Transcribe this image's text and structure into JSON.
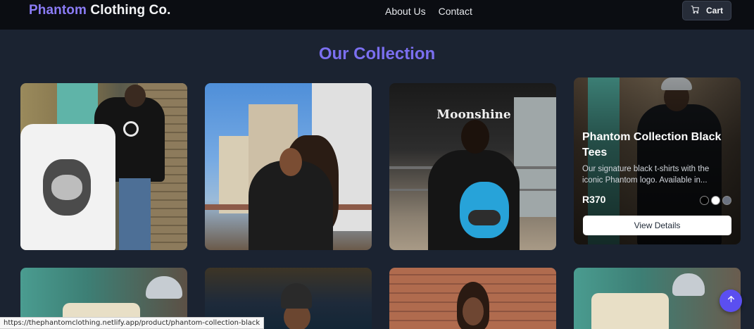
{
  "header": {
    "brand_accent": "Phantom",
    "brand_rest": "Clothing Co.",
    "nav": [
      {
        "label": "About Us"
      },
      {
        "label": "Contact"
      }
    ],
    "cart_label": "Cart"
  },
  "main": {
    "section_title": "Our Collection",
    "featured_product": {
      "title": "Phantom Collection Black Tees",
      "description": "Our signature black t-shirts with the iconic Phantom logo. Available in...",
      "price": "R370",
      "swatch_colors": [
        "#000000",
        "#ffffff",
        "#6b7280"
      ],
      "button_label": "View Details"
    },
    "storefront_sign": "Moonshine"
  },
  "status_bar": {
    "url": "https://thephantomclothing.netlify.app/product/phantom-collection-black"
  },
  "colors": {
    "accent": "#7b6ff0",
    "background": "#1b2331",
    "header_bg": "#0b0d12",
    "scroll_button": "#5b4ff0"
  },
  "icons": {
    "cart": "cart-icon",
    "scroll_top": "arrow-up-icon"
  }
}
